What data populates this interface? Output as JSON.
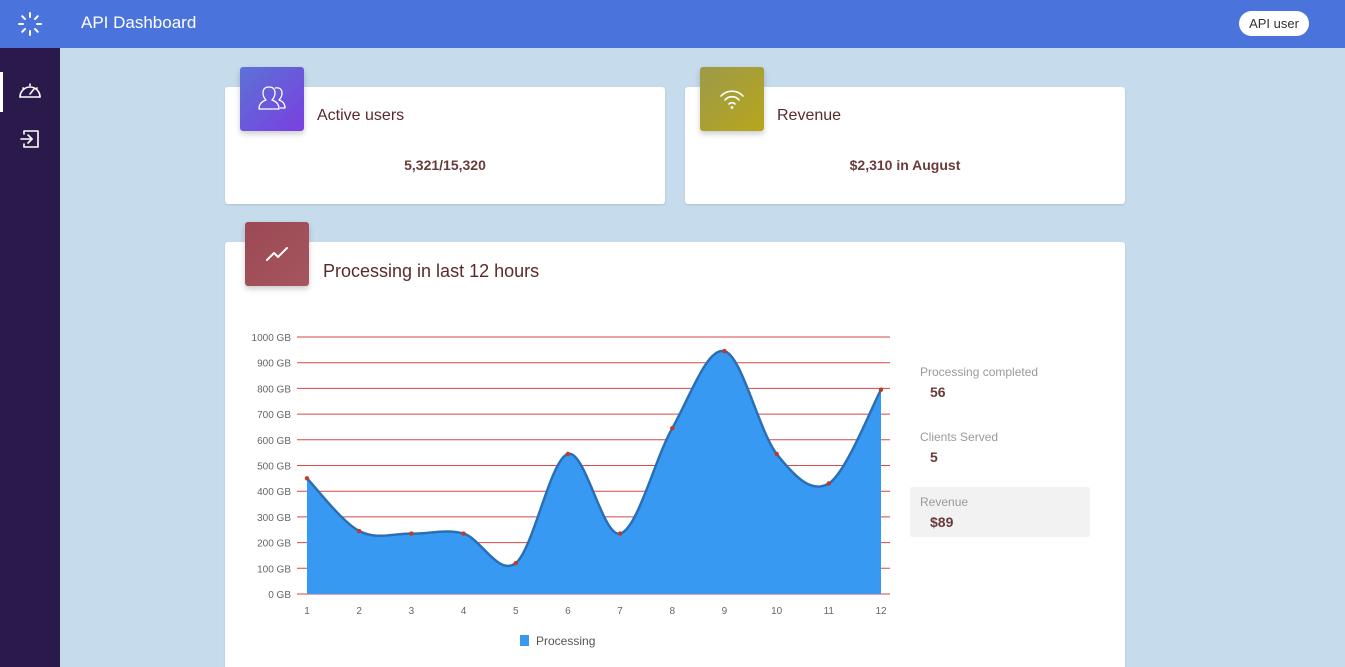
{
  "header": {
    "title": "API Dashboard",
    "user_label": "API user"
  },
  "cards": {
    "active_users": {
      "title": "Active users",
      "value": "5,321/15,320"
    },
    "revenue": {
      "title": "Revenue",
      "value": "$2,310 in August"
    }
  },
  "processing": {
    "title": "Processing in last 12 hours",
    "stats": [
      {
        "label": "Processing completed",
        "value": "56"
      },
      {
        "label": "Clients Served",
        "value": "5"
      },
      {
        "label": "Revenue",
        "value": "$89"
      }
    ]
  },
  "colors": {
    "header": "#4a73dc",
    "sidebar": "#2a1a4b",
    "background": "#c6dbeb",
    "area_fill": "#3799f2",
    "area_stroke": "#2a6fb6",
    "gridline": "#d24a4a",
    "point": "#c0392b"
  },
  "icons": {
    "logo": "spinner-icon",
    "nav_dashboard": "speedometer-icon",
    "nav_logout": "logout-icon",
    "active_users": "users-icon",
    "revenue": "wifi-icon",
    "processing": "trend-icon"
  },
  "chart_data": {
    "type": "area",
    "x": [
      "1",
      "2",
      "3",
      "4",
      "5",
      "6",
      "7",
      "8",
      "9",
      "10",
      "11",
      "12"
    ],
    "series": [
      {
        "name": "Processing",
        "values": [
          450,
          245,
          235,
          235,
          120,
          545,
          235,
          645,
          945,
          545,
          430,
          795
        ]
      }
    ],
    "y_ticks": [
      "0 GB",
      "100 GB",
      "200 GB",
      "300 GB",
      "400 GB",
      "500 GB",
      "600 GB",
      "700 GB",
      "800 GB",
      "900 GB",
      "1000 GB"
    ],
    "ylim": [
      0,
      1000
    ],
    "grid": true,
    "legend_position": "bottom"
  }
}
